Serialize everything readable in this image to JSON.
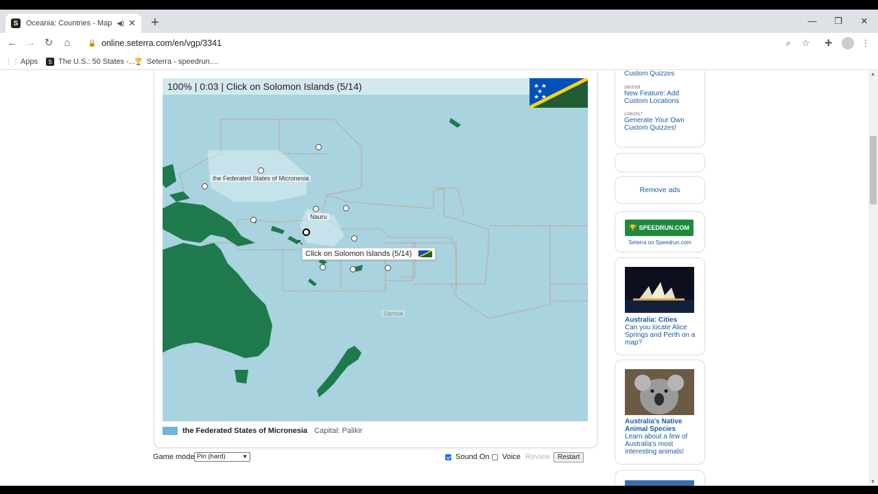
{
  "browser": {
    "tab_title": "Oceania: Countries - Map Qu",
    "url": "online.seterra.com/en/vgp/3341",
    "bookmarks": [
      "Apps",
      "The U.S.: 50 States -...",
      "Seterra - speedrun...."
    ]
  },
  "game": {
    "status": "100% | 0:03 | Click on Solomon Islands (5/14)",
    "tooltip": "Click on Solomon Islands (5/14)",
    "labels": {
      "micronesia": "the Federated States of Micronesia",
      "nauru": "Nauru",
      "samoa": "Samoa"
    },
    "footer_country": "the Federated States of Micronesia",
    "footer_capital": "Capital: Palikir",
    "game_mode_label": "Game mode:",
    "game_mode_value": "Pin (hard)",
    "sound_label": "Sound On",
    "voice_label": "Voice",
    "review_label": "Review",
    "restart_label": "Restart",
    "colors": {
      "land": "#1e7a4c",
      "sea": "#a8d3df",
      "border": "#e0704a"
    }
  },
  "sidebar": {
    "news": [
      {
        "date": "",
        "title": "Custom Quizzes"
      },
      {
        "date": "3/8/2019",
        "title": "New Feature: Add Custom Locations"
      },
      {
        "date": "12/6/2017",
        "title": "Generate Your Own Custom Quizzes!"
      }
    ],
    "remove_ads": "Remove ads",
    "speedrun_logo": "SPEEDRUN.COM",
    "speedrun_caption": "Seterra on Speedrun.com",
    "articles": [
      {
        "title": "Australia: Cities",
        "desc": "Can you locate Alice Springs and Perth on a map?"
      },
      {
        "title": "Australia's Native Animal Species",
        "desc": "Learn about a few of Australia's most interesting animals!"
      }
    ]
  }
}
